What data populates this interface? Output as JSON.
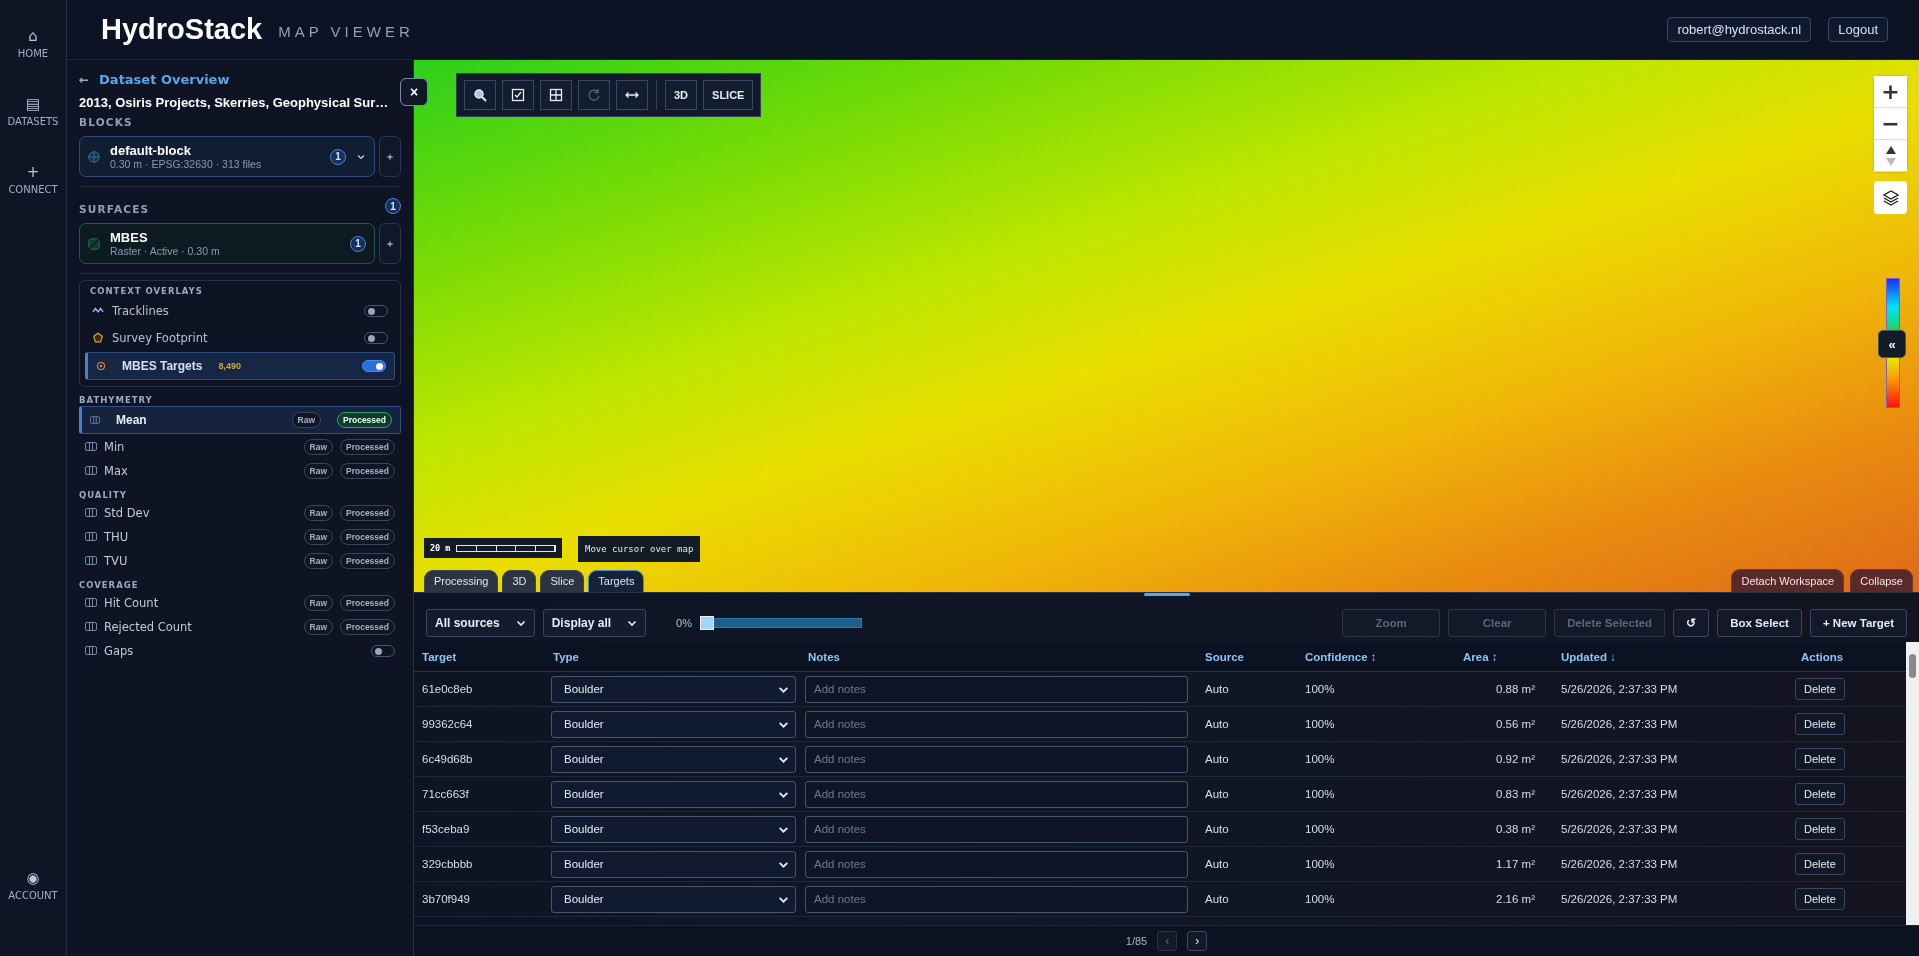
{
  "nav_rail": {
    "items": [
      {
        "icon": "⌂",
        "label": "HOME"
      },
      {
        "icon": "▤",
        "label": "DATASETS"
      },
      {
        "icon": "+",
        "label": "CONNECT"
      }
    ],
    "account": {
      "icon": "◉",
      "label": "ACCOUNT"
    }
  },
  "header": {
    "title": "HydroStack",
    "subtitle": "MAP VIEWER",
    "user": "robert@hydrostack.nl",
    "logout": "Logout"
  },
  "sidebar": {
    "back_arrow": "←",
    "back_link": "Dataset Overview",
    "close": "×",
    "dataset_title": "2013, Osiris Projects, Skerries, Geophysical Sur…",
    "blocks": {
      "heading": "BLOCKS",
      "items": [
        {
          "name": "default-block",
          "meta": "0.30 m · EPSG:32630 · 313 files",
          "count": "1",
          "expanded": false
        }
      ]
    },
    "surfaces": {
      "heading": "SURFACES",
      "count": "1",
      "items": [
        {
          "name": "MBES",
          "meta": "Raster · Active · 0.30 m",
          "count": "1"
        }
      ]
    },
    "context_overlays": {
      "heading": "CONTEXT OVERLAYS",
      "items": [
        {
          "kind": "tracklines",
          "label": "Tracklines",
          "on": false,
          "selected": false
        },
        {
          "kind": "footprint",
          "label": "Survey Footprint",
          "on": false,
          "selected": false
        },
        {
          "kind": "targets",
          "label": "MBES Targets",
          "count": "8,490",
          "on": true,
          "selected": true
        }
      ]
    },
    "layer_groups": [
      {
        "heading": "BATHYMETRY",
        "items": [
          {
            "kind": "pills",
            "label": "Mean",
            "selected": true,
            "pills": [
              {
                "label": "Raw",
                "selected": false
              },
              {
                "label": "Processed",
                "selected": true
              }
            ]
          },
          {
            "kind": "pills",
            "label": "Min",
            "selected": false,
            "pills": [
              {
                "label": "Raw",
                "selected": false
              },
              {
                "label": "Processed",
                "selected": false
              }
            ]
          },
          {
            "kind": "pills",
            "label": "Max",
            "selected": false,
            "pills": [
              {
                "label": "Raw",
                "selected": false
              },
              {
                "label": "Processed",
                "selected": false
              }
            ]
          }
        ]
      },
      {
        "heading": "QUALITY",
        "items": [
          {
            "kind": "pills",
            "label": "Std Dev",
            "selected": false,
            "pills": [
              {
                "label": "Raw",
                "selected": false
              },
              {
                "label": "Processed",
                "selected": false
              }
            ]
          },
          {
            "kind": "pills",
            "label": "THU",
            "selected": false,
            "pills": [
              {
                "label": "Raw",
                "selected": false
              },
              {
                "label": "Processed",
                "selected": false
              }
            ]
          },
          {
            "kind": "pills",
            "label": "TVU",
            "selected": false,
            "pills": [
              {
                "label": "Raw",
                "selected": false
              },
              {
                "label": "Processed",
                "selected": false
              }
            ]
          }
        ]
      },
      {
        "heading": "COVERAGE",
        "items": [
          {
            "kind": "pills",
            "label": "Hit Count",
            "selected": false,
            "pills": [
              {
                "label": "Raw",
                "selected": false
              },
              {
                "label": "Processed",
                "selected": false
              }
            ]
          },
          {
            "kind": "pills",
            "label": "Rejected Count",
            "selected": false,
            "pills": [
              {
                "label": "Raw",
                "selected": false
              },
              {
                "label": "Processed",
                "selected": false
              }
            ]
          },
          {
            "kind": "toggle",
            "label": "Gaps",
            "selected": false,
            "on": false
          }
        ]
      }
    ]
  },
  "map": {
    "toolbar": [
      {
        "kind": "search",
        "disabled": false
      },
      {
        "kind": "checkbox",
        "disabled": false
      },
      {
        "kind": "grid",
        "disabled": false
      },
      {
        "kind": "rotate",
        "disabled": true
      },
      {
        "kind": "measure",
        "disabled": false
      },
      {
        "kind": "text",
        "label": "3D",
        "disabled": false
      },
      {
        "kind": "text",
        "label": "SLICE",
        "disabled": false
      }
    ],
    "zoom_in": "+",
    "zoom_out": "−",
    "legend_toggle": "«",
    "scale_label": "20 m",
    "cursor_readout": "Move cursor over map",
    "tabs": [
      {
        "label": "Processing",
        "selected": false
      },
      {
        "label": "3D",
        "selected": false
      },
      {
        "label": "Slice",
        "selected": false
      },
      {
        "label": "Targets",
        "selected": true
      }
    ],
    "actions": [
      "Detach Workspace",
      "Collapse"
    ]
  },
  "targets_panel": {
    "filters": [
      {
        "value": "All sources"
      },
      {
        "value": "Display all"
      }
    ],
    "slider": {
      "reading": "0%",
      "level": 0
    },
    "buttons": [
      {
        "label": "Zoom",
        "disabled": true
      },
      {
        "label": "Clear",
        "disabled": true
      },
      {
        "label": "Delete Selected",
        "disabled": true
      },
      {
        "label": "↺",
        "disabled": false
      },
      {
        "label": "Box Select",
        "disabled": false
      },
      {
        "label": "+  New Target",
        "disabled": false
      }
    ],
    "table": {
      "columns": [
        {
          "label": "Target"
        },
        {
          "label": "Type"
        },
        {
          "label": "Notes"
        },
        {
          "label": "Source"
        },
        {
          "label": "Confidence",
          "sort": "↕"
        },
        {
          "label": "Area",
          "sort": "↕"
        },
        {
          "label": "Updated",
          "sort": "↓"
        },
        {
          "label": "Actions"
        }
      ],
      "rows": [
        {
          "target": "61e0c8eb",
          "type": "Boulder",
          "notes_placeholder": "Add notes",
          "source": "Auto",
          "confidence": "100%",
          "area": "0.88 m²",
          "updated": "5/26/2026, 2:37:33 PM",
          "action": "Delete"
        },
        {
          "target": "99362c64",
          "type": "Boulder",
          "notes_placeholder": "Add notes",
          "source": "Auto",
          "confidence": "100%",
          "area": "0.56 m²",
          "updated": "5/26/2026, 2:37:33 PM",
          "action": "Delete"
        },
        {
          "target": "6c49d68b",
          "type": "Boulder",
          "notes_placeholder": "Add notes",
          "source": "Auto",
          "confidence": "100%",
          "area": "0.92 m²",
          "updated": "5/26/2026, 2:37:33 PM",
          "action": "Delete"
        },
        {
          "target": "71cc663f",
          "type": "Boulder",
          "notes_placeholder": "Add notes",
          "source": "Auto",
          "confidence": "100%",
          "area": "0.83 m²",
          "updated": "5/26/2026, 2:37:33 PM",
          "action": "Delete"
        },
        {
          "target": "f53ceba9",
          "type": "Boulder",
          "notes_placeholder": "Add notes",
          "source": "Auto",
          "confidence": "100%",
          "area": "0.38 m²",
          "updated": "5/26/2026, 2:37:33 PM",
          "action": "Delete"
        },
        {
          "target": "329cbbbb",
          "type": "Boulder",
          "notes_placeholder": "Add notes",
          "source": "Auto",
          "confidence": "100%",
          "area": "1.17 m²",
          "updated": "5/26/2026, 2:37:33 PM",
          "action": "Delete"
        },
        {
          "target": "3b70f949",
          "type": "Boulder",
          "notes_placeholder": "Add notes",
          "source": "Auto",
          "confidence": "100%",
          "area": "2.16 m²",
          "updated": "5/26/2026, 2:37:33 PM",
          "action": "Delete"
        }
      ]
    },
    "pagination": {
      "page": "1/85",
      "prev": "‹",
      "next": "›",
      "prev_disabled": true
    }
  }
}
